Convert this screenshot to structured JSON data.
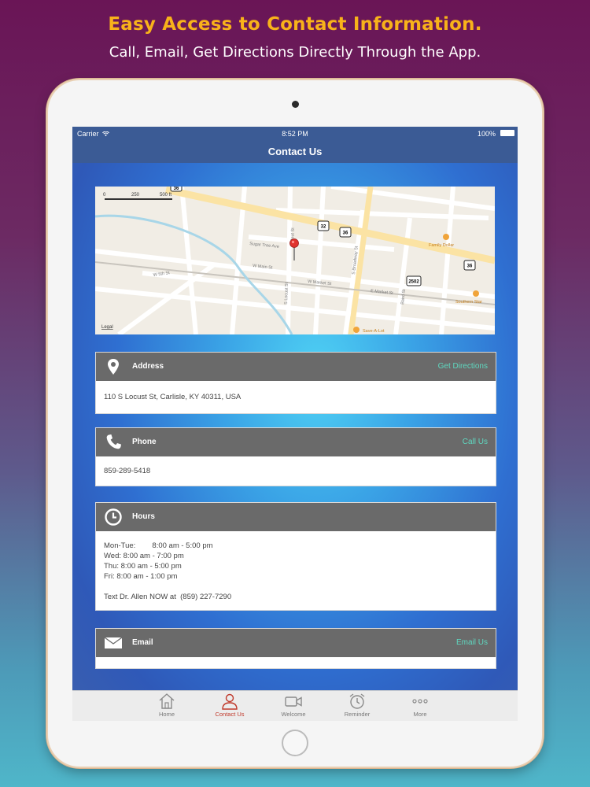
{
  "promo": {
    "headline": "Easy Access to Contact Information.",
    "subline": "Call, Email, Get Directions Directly Through the App."
  },
  "status_bar": {
    "carrier": "Carrier",
    "time": "8:52 PM",
    "battery": "100%"
  },
  "nav": {
    "title": "Contact Us"
  },
  "map": {
    "scale_0": "0",
    "scale_250": "250",
    "scale_500": "500 ft",
    "legal": "Legal",
    "streets": [
      "Sugar Tree Ave",
      "W Main St",
      "W Market St",
      "W 5th St",
      "E Market St",
      "S Locust St",
      "S Broadway St",
      "Walnut St",
      "Baird St"
    ],
    "routes": [
      "32",
      "36",
      "36",
      "2502",
      "36"
    ],
    "pois": [
      "Family Dollar",
      "Southern Star",
      "Save-A-Lot"
    ]
  },
  "cards": {
    "address": {
      "title": "Address",
      "action": "Get Directions",
      "text": "110 S Locust St, Carlisle, KY 40311, USA"
    },
    "phone": {
      "title": "Phone",
      "action": "Call Us",
      "text": "859-289-5418"
    },
    "hours": {
      "title": "Hours",
      "lines": [
        "Mon-Tue:        8:00 am - 5:00 pm",
        "Wed: 8:00 am - 7:00 pm",
        "Thu: 8:00 am - 5:00 pm",
        "Fri: 8:00 am - 1:00 pm"
      ],
      "text_line": "Text Dr. Allen NOW at  (859) 227-7290"
    },
    "email": {
      "title": "Email",
      "action": "Email Us"
    }
  },
  "tabs": [
    {
      "label": "Home",
      "icon": "home-icon"
    },
    {
      "label": "Contact Us",
      "icon": "person-icon"
    },
    {
      "label": "Welcome",
      "icon": "video-camera-icon"
    },
    {
      "label": "Reminder",
      "icon": "alarm-clock-icon"
    },
    {
      "label": "More",
      "icon": "more-dots-icon"
    }
  ],
  "colors": {
    "accent_header": "#f8b21a",
    "card_header": "#6a6a6a",
    "action_link": "#5fd8c0",
    "active_tab": "#c0392b",
    "nav_bar": "#3b5b95"
  }
}
